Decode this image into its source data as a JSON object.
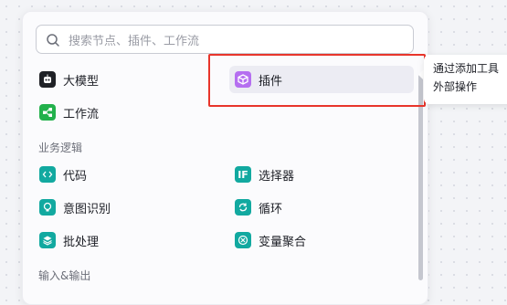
{
  "search": {
    "placeholder": "搜索节点、插件、工作流"
  },
  "nodes": {
    "llm": {
      "label": "大模型",
      "icon": "robot-icon",
      "color": "#1f2126"
    },
    "plugin": {
      "label": "插件",
      "icon": "cube-icon",
      "color": "#b56ff0"
    },
    "workflow": {
      "label": "工作流",
      "icon": "flow-icon",
      "color": "#22b14c"
    }
  },
  "sections": {
    "logic": {
      "title": "业务逻辑",
      "items": {
        "code": {
          "label": "代码",
          "icon": "code-icon",
          "color": "#12a9a0"
        },
        "selector": {
          "label": "选择器",
          "icon": "if-icon",
          "color": "#12a9a0"
        },
        "intent": {
          "label": "意图识别",
          "icon": "bulb-icon",
          "color": "#12a9a0"
        },
        "loop": {
          "label": "循环",
          "icon": "loop-icon",
          "color": "#12a9a0"
        },
        "batch": {
          "label": "批处理",
          "icon": "layers-icon",
          "color": "#12a9a0"
        },
        "aggregate": {
          "label": "变量聚合",
          "icon": "aggregate-icon",
          "color": "#12a9a0"
        }
      }
    },
    "io": {
      "title": "输入&输出"
    }
  },
  "tooltip": {
    "line1": "通过添加工具",
    "line2": "外部操作"
  },
  "highlight_color": "#e8352b"
}
